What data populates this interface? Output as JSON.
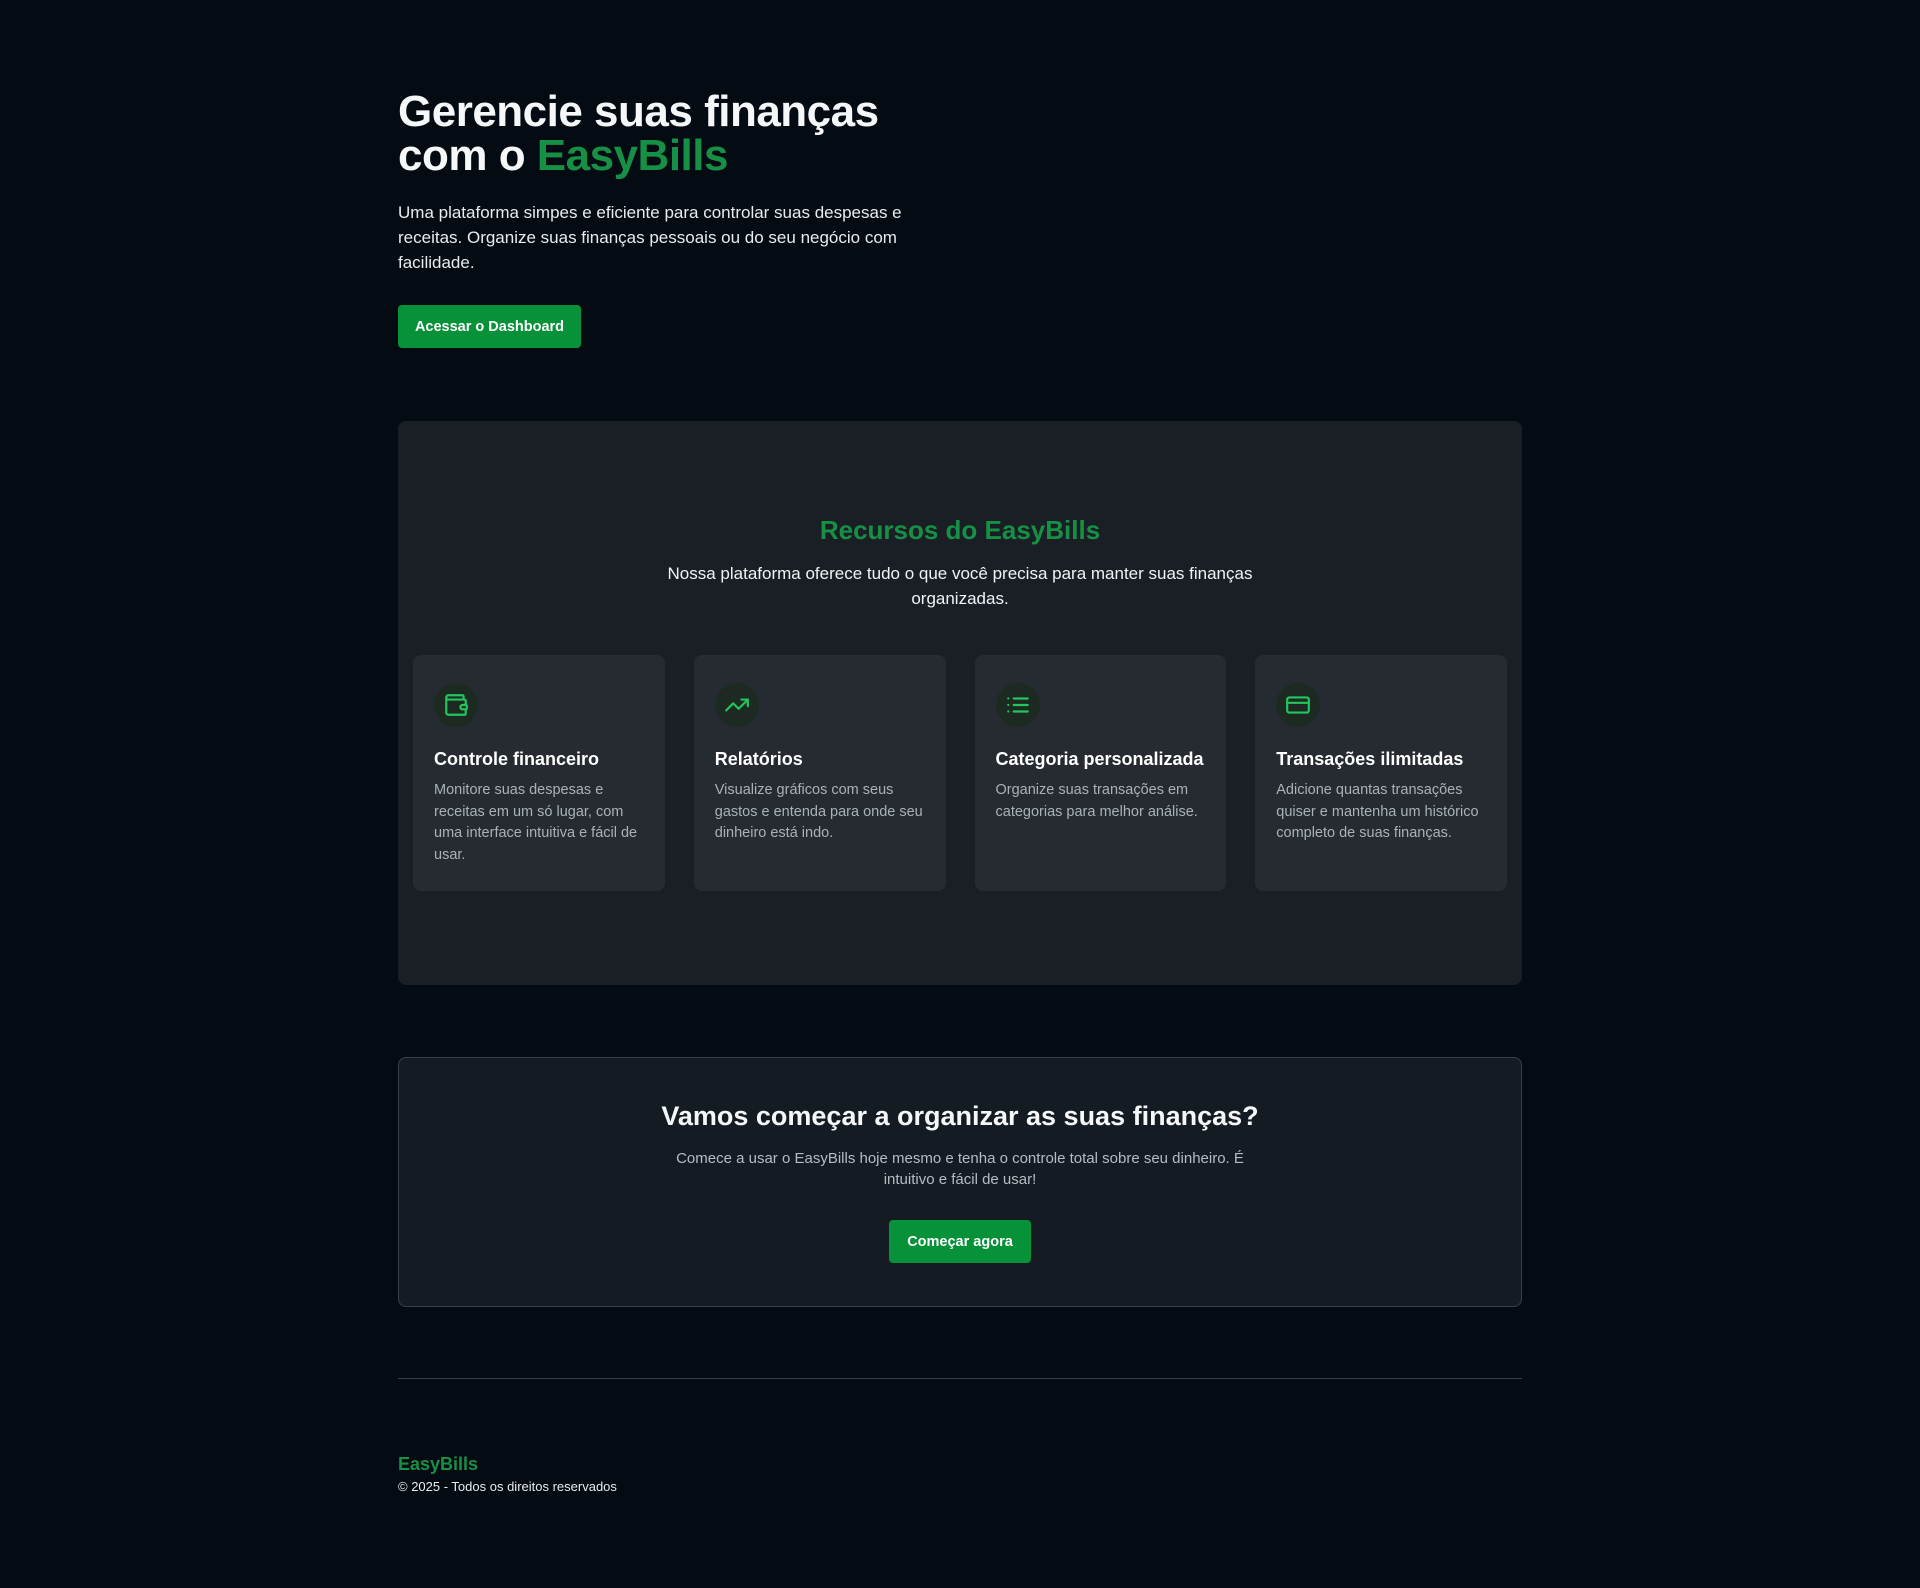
{
  "hero": {
    "title_line1": "Gerencie suas finanças",
    "title_prefix": "com o ",
    "title_brand": "EasyBills",
    "description": "Uma plataforma simpes e eficiente para controlar suas despesas e receitas. Organize suas finanças pessoais ou do seu negócio com facilidade.",
    "cta_label": "Acessar o Dashboard"
  },
  "features": {
    "title": "Recursos do EasyBills",
    "subtitle": "Nossa plataforma oferece tudo o que você precisa para manter suas finanças organizadas.",
    "cards": [
      {
        "icon": "wallet-icon",
        "title": "Controle financeiro",
        "description": "Monitore suas despesas e receitas em um só lugar, com uma interface intuitiva e fácil de usar."
      },
      {
        "icon": "trending-up-icon",
        "title": "Relatórios",
        "description": "Visualize gráficos com seus gastos e entenda para onde seu dinheiro está indo."
      },
      {
        "icon": "list-icon",
        "title": "Categoria personalizada",
        "description": "Organize suas transações em categorias para melhor análise."
      },
      {
        "icon": "credit-card-icon",
        "title": "Transações ilimitadas",
        "description": "Adicione quantas transações quiser e mantenha um histórico completo de suas finanças."
      }
    ]
  },
  "cta": {
    "title": "Vamos começar a organizar as suas finanças?",
    "description": "Comece a usar o EasyBills hoje mesmo e tenha o controle total sobre seu dinheiro. É intuitivo e fácil de usar!",
    "button_label": "Começar agora"
  },
  "footer": {
    "brand": "EasyBills",
    "copyright": "© 2025 - Todos os direitos reservados"
  },
  "colors": {
    "background": "#050b12",
    "accent": "#169044",
    "button": "#079139",
    "panel": "#1a1f26",
    "card": "#262b32",
    "icon": "#22c55e"
  }
}
